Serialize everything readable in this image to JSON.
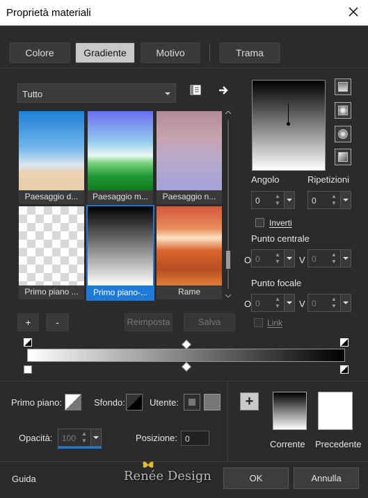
{
  "window": {
    "title": "Proprietà materiali",
    "close_icon": "close-icon"
  },
  "tabs": [
    "Colore",
    "Gradiente",
    "Motivo",
    "Trama"
  ],
  "active_tab": "Gradiente",
  "library": {
    "selected": "Tutto"
  },
  "swatches": [
    {
      "label": "Paesaggio d..."
    },
    {
      "label": "Paesaggio m..."
    },
    {
      "label": "Paesaggio n..."
    },
    {
      "label": "Primo piano ..."
    },
    {
      "label": "Primo piano-..."
    },
    {
      "label": "Rame"
    }
  ],
  "selected_swatch": "Primo piano-...",
  "buttons": {
    "add": "+",
    "remove": "-",
    "reset": "Reimposta",
    "save": "Salva"
  },
  "angle": {
    "label": "Angolo",
    "value": "0"
  },
  "repeats": {
    "label": "Ripetizioni",
    "value": "0"
  },
  "invert": {
    "label": "Inverti",
    "checked": false
  },
  "center_point": {
    "label": "Punto centrale",
    "o_label": "O",
    "v_label": "V",
    "o_value": "0",
    "v_value": "0"
  },
  "focal_point": {
    "label": "Punto focale",
    "o_label": "O",
    "v_label": "V",
    "o_value": "0",
    "v_value": "0"
  },
  "link": {
    "label": "Link",
    "checked": false
  },
  "bottom": {
    "foreground_label": "Primo piano:",
    "background_label": "Sfondo:",
    "user_label": "Utente:",
    "opacity_label": "Opacità:",
    "opacity_value": "100",
    "position_label": "Posizione:",
    "position_value": "0",
    "current_label": "Corrente",
    "previous_label": "Precedente",
    "add_icon": "+"
  },
  "footer": {
    "help": "Guida",
    "ok": "OK",
    "cancel": "Annulla",
    "watermark": "Renée Design"
  },
  "colors": {
    "accent": "#1e7ad6",
    "bg": "#2b2b2b"
  }
}
